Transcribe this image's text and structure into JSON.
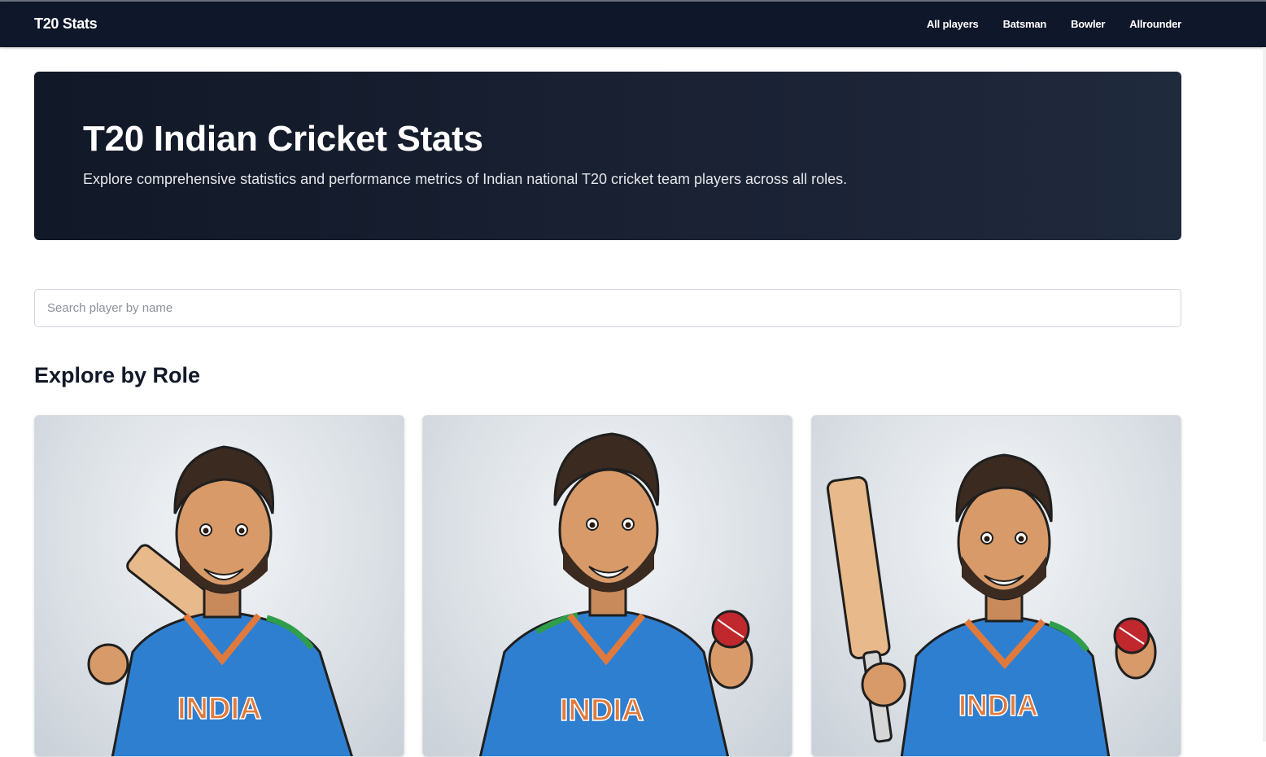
{
  "navbar": {
    "brand": "T20 Stats",
    "links": [
      "All players",
      "Batsman",
      "Bowler",
      "Allrounder"
    ]
  },
  "hero": {
    "title": "T20 Indian Cricket Stats",
    "subtitle": "Explore comprehensive statistics and performance metrics of Indian national T20 cricket team players across all roles."
  },
  "search": {
    "placeholder": "Search player by name",
    "value": ""
  },
  "section": {
    "title": "Explore by Role"
  },
  "role_cards": [
    {
      "image": "batsman-cartoon",
      "jersey_text": "INDIA"
    },
    {
      "image": "bowler-cartoon",
      "jersey_text": "INDIA"
    },
    {
      "image": "allrounder-cartoon",
      "jersey_text": "INDIA"
    }
  ],
  "colors": {
    "navbar": "#0f172a",
    "hero": "#111827",
    "jersey_blue": "#2f7fd1",
    "jersey_text": "#e07a3c"
  }
}
